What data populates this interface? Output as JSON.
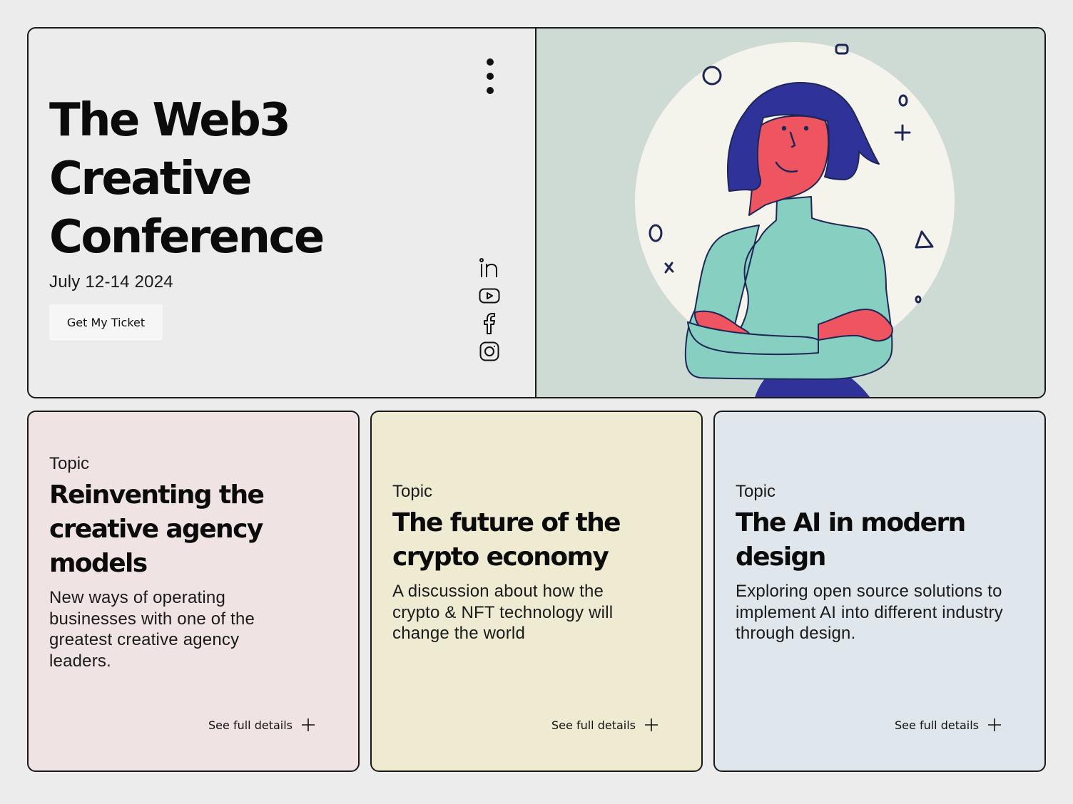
{
  "hero": {
    "title_lines": [
      "The Web3",
      "Creative",
      "Conference"
    ],
    "date": "July 12-14 2024",
    "cta_label": "Get My Ticket",
    "menu_icon": "more-vertical-icon",
    "socials": [
      {
        "name": "linkedin-icon"
      },
      {
        "name": "youtube-icon"
      },
      {
        "name": "facebook-icon"
      },
      {
        "name": "instagram-icon"
      }
    ],
    "illustration": "woman-arms-crossed-illustration"
  },
  "topics": [
    {
      "eyebrow": "Topic",
      "title": "Reinventing the creative agency models",
      "description": "New ways of operating businesses with one of the greatest creative agency leaders.",
      "link_label": "See full details"
    },
    {
      "eyebrow": "Topic",
      "title": "The future of the crypto economy",
      "description": "A discussion about how the crypto & NFT technology will change the world",
      "link_label": "See full details"
    },
    {
      "eyebrow": "Topic",
      "title": "The AI in modern design",
      "description": "Exploring open source solutions to implement AI into different industry through design.",
      "link_label": "See full details"
    }
  ],
  "colors": {
    "page_bg": "#ececec",
    "illustration_bg": "#cedbd5",
    "card_pink": "#f0e3e3",
    "card_yellow": "#efebd3",
    "card_blue": "#dfe6ec",
    "hair": "#2f3298",
    "skin": "#ef5461",
    "sweater": "#86cfc1"
  }
}
